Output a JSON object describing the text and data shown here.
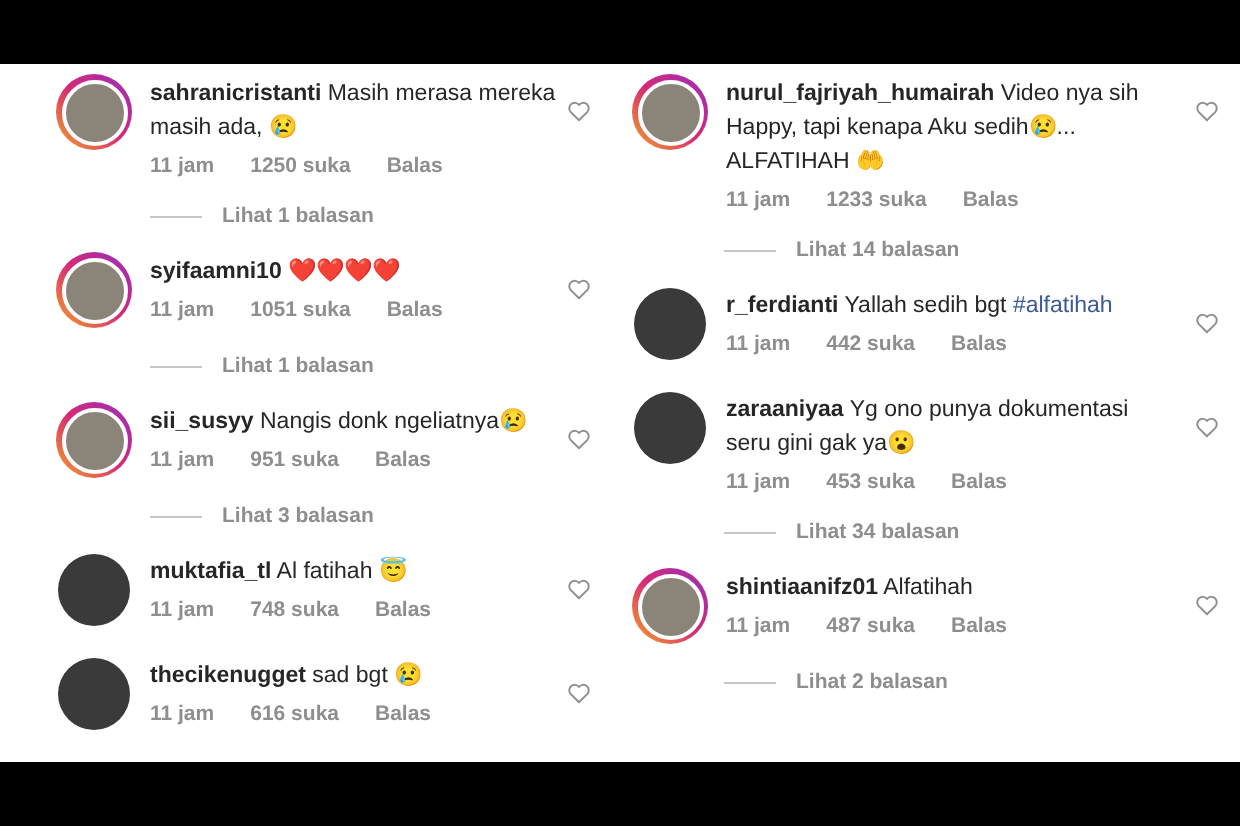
{
  "columns": [
    {
      "comments": [
        {
          "username": "sahranicristanti",
          "text": "Masih merasa mereka masih ada, 😢",
          "story_ring": true,
          "time": "11 jam",
          "likes": "1250 suka",
          "reply": "Balas",
          "replies_link": "Lihat 1 balasan"
        },
        {
          "username": "syifaamni10",
          "text": "❤️❤️❤️❤️",
          "story_ring": true,
          "time": "11 jam",
          "likes": "1051 suka",
          "reply": "Balas",
          "replies_link": "Lihat 1 balasan"
        },
        {
          "username": "sii_susyy",
          "text": "Nangis donk ngeliatnya😢",
          "story_ring": true,
          "time": "11 jam",
          "likes": "951 suka",
          "reply": "Balas",
          "replies_link": "Lihat 3 balasan"
        },
        {
          "username": "muktafia_tl",
          "text": "Al fatihah 😇",
          "story_ring": false,
          "time": "11 jam",
          "likes": "748 suka",
          "reply": "Balas"
        },
        {
          "username": "thecikenugget",
          "text": "sad bgt 😢",
          "story_ring": false,
          "time": "11 jam",
          "likes": "616 suka",
          "reply": "Balas"
        }
      ]
    },
    {
      "comments": [
        {
          "username": "nurul_fajriyah_humairah",
          "text": "Video nya sih Happy, tapi kenapa Aku sedih😢... ALFATIHAH 🤲",
          "story_ring": true,
          "time": "11 jam",
          "likes": "1233 suka",
          "reply": "Balas",
          "replies_link": "Lihat 14 balasan"
        },
        {
          "username": "r_ferdianti",
          "text": "Yallah sedih bgt",
          "hashtag": "#alfatihah",
          "story_ring": false,
          "time": "11 jam",
          "likes": "442 suka",
          "reply": "Balas"
        },
        {
          "username": "zaraaniyaa",
          "text": "Yg ono punya dokumentasi seru gini gak ya😮",
          "story_ring": false,
          "time": "11 jam",
          "likes": "453 suka",
          "reply": "Balas",
          "replies_link": "Lihat 34 balasan"
        },
        {
          "username": "shintiaanifz01",
          "text": "Alfatihah",
          "story_ring": true,
          "time": "11 jam",
          "likes": "487 suka",
          "reply": "Balas",
          "replies_link": "Lihat 2 balasan"
        }
      ]
    }
  ]
}
